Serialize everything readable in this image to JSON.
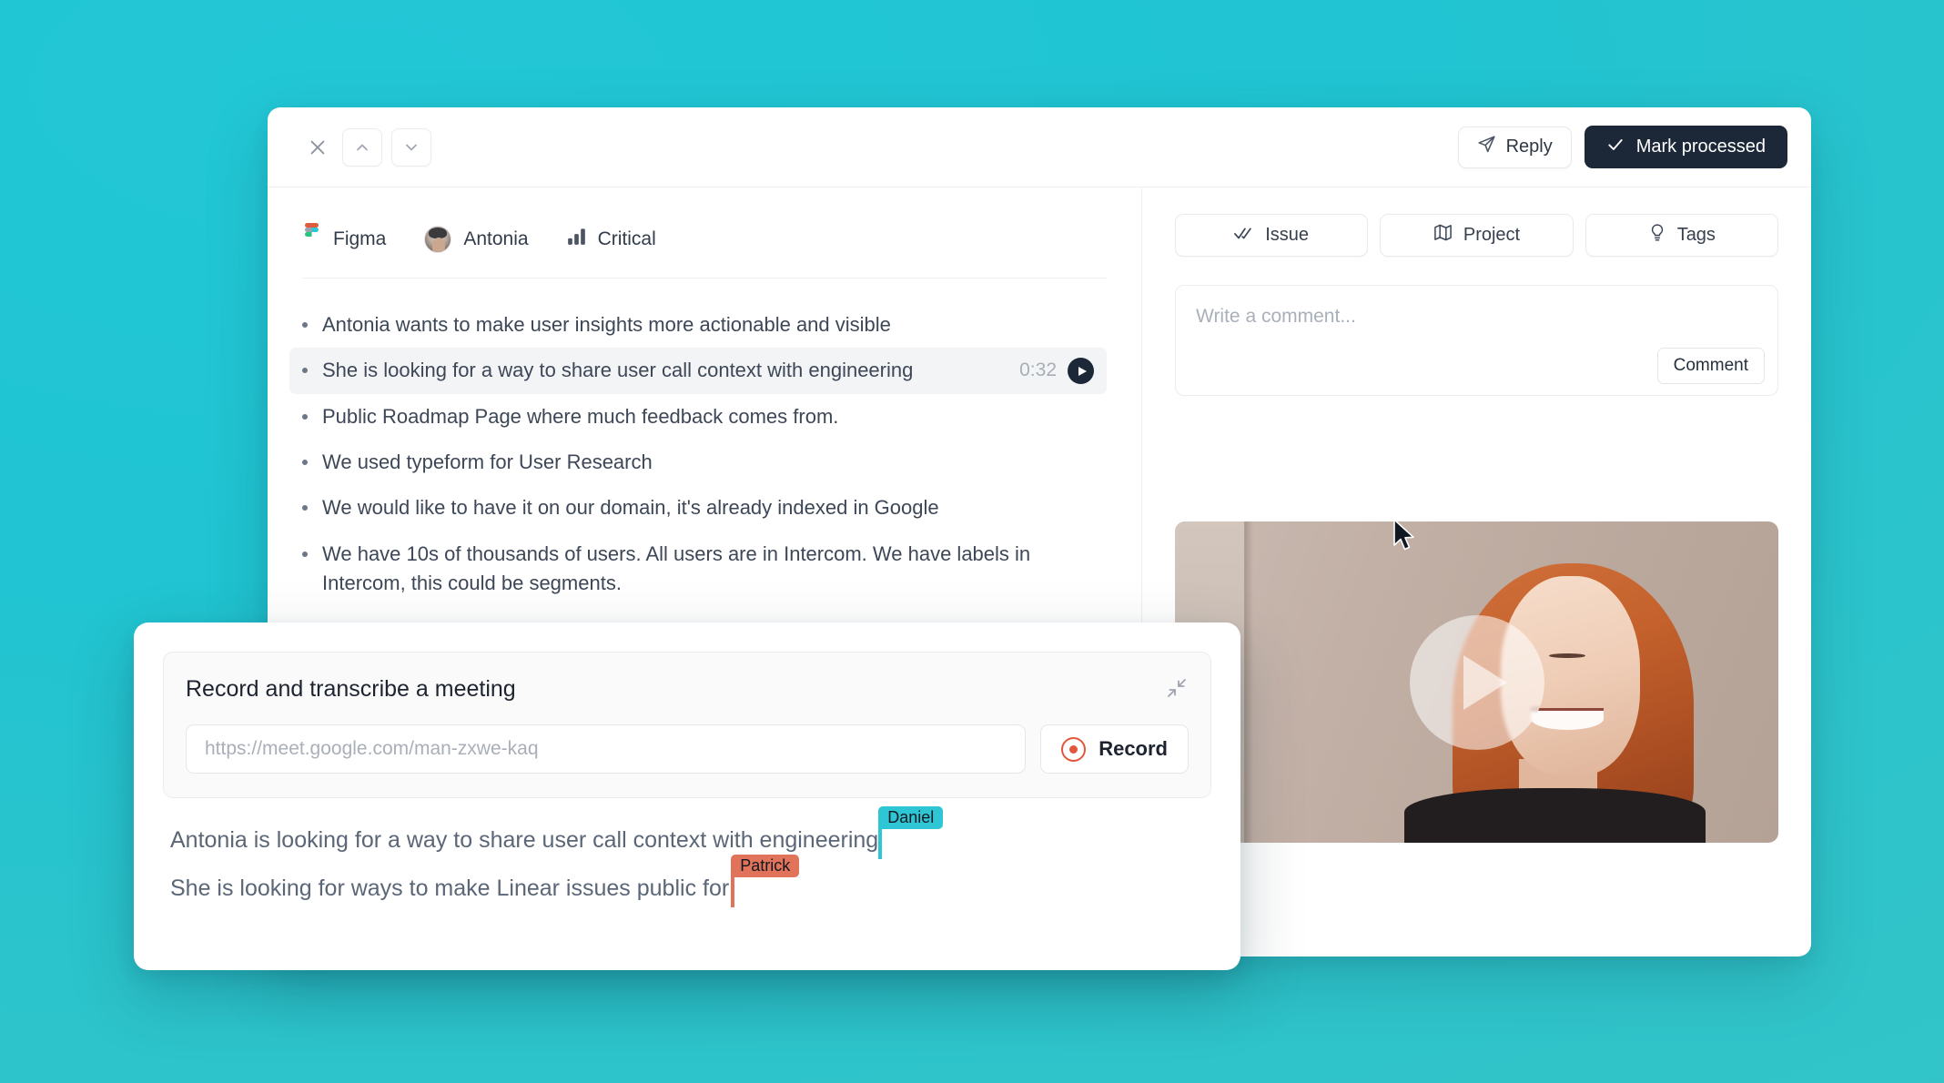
{
  "theme": {
    "background_gradient_start": "#22c7d6",
    "background_gradient_end": "#33c3c6",
    "accent_dark": "#1c2837",
    "record_accent": "#e2573a"
  },
  "main_window": {
    "topbar": {
      "close_label": "×",
      "prev_label": "⌃",
      "next_label": "⌄",
      "reply_label": "Reply",
      "mark_processed_label": "Mark processed"
    },
    "meta": [
      {
        "icon": "figma-icon",
        "label": "Figma"
      },
      {
        "icon": "avatar-icon",
        "label": "Antonia"
      },
      {
        "icon": "priority-bars-icon",
        "label": "Critical"
      }
    ],
    "bullets": [
      {
        "text": "Antonia wants to make user insights more actionable and visible",
        "active": false,
        "timestamp": ""
      },
      {
        "text": "She is looking for a way to share user call context with engineering",
        "active": true,
        "timestamp": "0:32"
      },
      {
        "text": "Public Roadmap Page where much feedback comes from.",
        "active": false,
        "timestamp": ""
      },
      {
        "text": "We used typeform for User Research",
        "active": false,
        "timestamp": ""
      },
      {
        "text": "We would like to have it on our domain, it's already indexed in Google",
        "active": false,
        "timestamp": ""
      },
      {
        "text": "We have 10s of thousands of users. All users are in Intercom. We have labels in Intercom, this could be segments.",
        "active": false,
        "timestamp": ""
      }
    ],
    "sidebar": {
      "chips": [
        {
          "icon": "double-check-icon",
          "label": "Issue"
        },
        {
          "icon": "map-icon",
          "label": "Project"
        },
        {
          "icon": "lightbulb-icon",
          "label": "Tags"
        }
      ],
      "comment": {
        "placeholder": "Write a comment...",
        "value": "",
        "submit_label": "Comment"
      },
      "video": {
        "alt": "recorded call thumbnail",
        "play_label": "play"
      }
    }
  },
  "overlay_card": {
    "recorder": {
      "title": "Record and transcribe a meeting",
      "collapse_icon": "collapse-icon",
      "url_value": "",
      "url_placeholder": "https://meet.google.com/man-zxwe-kaq",
      "record_label": "Record"
    },
    "transcript": [
      {
        "text": "Antonia is looking for a way to share user call context with engineering",
        "cursor": {
          "name": "Daniel",
          "color": "#2ec6d4"
        }
      },
      {
        "text": "She is looking for ways to make Linear issues public for",
        "cursor": {
          "name": "Patrick",
          "color": "#e0735a"
        }
      }
    ]
  }
}
